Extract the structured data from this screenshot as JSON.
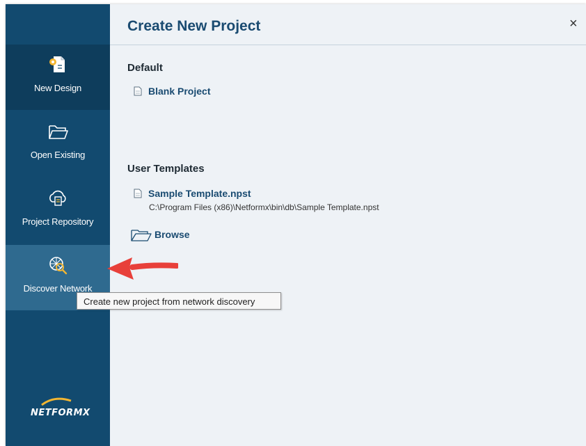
{
  "dialog": {
    "title": "Create New Project",
    "close_label": "×"
  },
  "sidebar": {
    "items": [
      {
        "label": "New Design",
        "icon": "new-design-icon"
      },
      {
        "label": "Open Existing",
        "icon": "folder-open-icon"
      },
      {
        "label": "Project Repository",
        "icon": "cloud-repository-icon"
      },
      {
        "label": "Discover Network",
        "icon": "network-discovery-icon"
      }
    ],
    "logo": "NETFORMX"
  },
  "default_section": {
    "heading": "Default",
    "blank_project": "Blank Project"
  },
  "user_templates": {
    "heading": "User Templates",
    "template_name": "Sample Template.npst",
    "template_path": "C:\\Program Files (x86)\\Netformx\\bin\\db\\Sample Template.npst",
    "browse": "Browse"
  },
  "tooltip": {
    "text": "Create new project from network discovery"
  },
  "colors": {
    "sidebar_bg": "#124a6f",
    "sidebar_active": "#0e3d5c",
    "sidebar_hover": "#2f6a8f",
    "title": "#1a4b71",
    "annotation_arrow": "#e8403a"
  }
}
